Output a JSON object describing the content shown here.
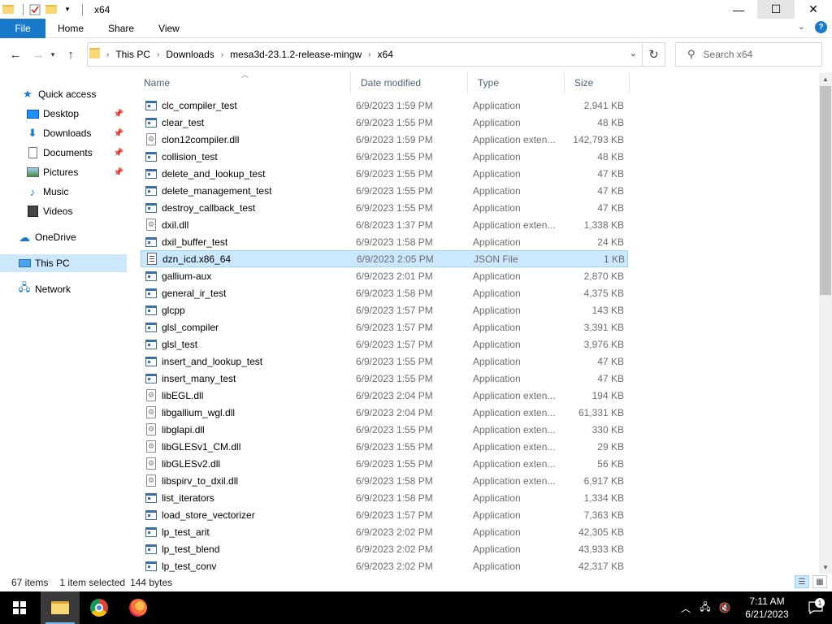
{
  "window": {
    "title": "x64",
    "minimize_glyph": "—",
    "maximize_glyph": "☐",
    "close_glyph": "✕"
  },
  "ribbon": {
    "tabs": [
      "File",
      "Home",
      "Share",
      "View"
    ]
  },
  "address": {
    "crumbs": [
      "This PC",
      "Downloads",
      "mesa3d-23.1.2-release-mingw",
      "x64"
    ],
    "search_placeholder": "Search x64"
  },
  "nav": {
    "quick_access": "Quick access",
    "items": [
      {
        "label": "Desktop",
        "icon": "desktop-icon",
        "pinned": true
      },
      {
        "label": "Downloads",
        "icon": "downloads-icon",
        "pinned": true
      },
      {
        "label": "Documents",
        "icon": "documents-icon",
        "pinned": true
      },
      {
        "label": "Pictures",
        "icon": "pictures-icon",
        "pinned": true
      },
      {
        "label": "Music",
        "icon": "music-icon",
        "pinned": false
      },
      {
        "label": "Videos",
        "icon": "videos-icon",
        "pinned": false
      }
    ],
    "onedrive": "OneDrive",
    "this_pc": "This PC",
    "network": "Network"
  },
  "columns": {
    "name": "Name",
    "date": "Date modified",
    "type": "Type",
    "size": "Size"
  },
  "files": [
    {
      "name": "clc_compiler_test",
      "date": "6/9/2023 1:59 PM",
      "type": "Application",
      "size": "2,941 KB",
      "kind": "app"
    },
    {
      "name": "clear_test",
      "date": "6/9/2023 1:55 PM",
      "type": "Application",
      "size": "48 KB",
      "kind": "app"
    },
    {
      "name": "clon12compiler.dll",
      "date": "6/9/2023 1:59 PM",
      "type": "Application exten...",
      "size": "142,793 KB",
      "kind": "dll"
    },
    {
      "name": "collision_test",
      "date": "6/9/2023 1:55 PM",
      "type": "Application",
      "size": "48 KB",
      "kind": "app"
    },
    {
      "name": "delete_and_lookup_test",
      "date": "6/9/2023 1:55 PM",
      "type": "Application",
      "size": "47 KB",
      "kind": "app"
    },
    {
      "name": "delete_management_test",
      "date": "6/9/2023 1:55 PM",
      "type": "Application",
      "size": "47 KB",
      "kind": "app"
    },
    {
      "name": "destroy_callback_test",
      "date": "6/9/2023 1:55 PM",
      "type": "Application",
      "size": "47 KB",
      "kind": "app"
    },
    {
      "name": "dxil.dll",
      "date": "6/8/2023 1:37 PM",
      "type": "Application exten...",
      "size": "1,338 KB",
      "kind": "dll"
    },
    {
      "name": "dxil_buffer_test",
      "date": "6/9/2023 1:58 PM",
      "type": "Application",
      "size": "24 KB",
      "kind": "app"
    },
    {
      "name": "dzn_icd.x86_64",
      "date": "6/9/2023 2:05 PM",
      "type": "JSON File",
      "size": "1 KB",
      "kind": "json",
      "selected": true
    },
    {
      "name": "gallium-aux",
      "date": "6/9/2023 2:01 PM",
      "type": "Application",
      "size": "2,870 KB",
      "kind": "app"
    },
    {
      "name": "general_ir_test",
      "date": "6/9/2023 1:58 PM",
      "type": "Application",
      "size": "4,375 KB",
      "kind": "app"
    },
    {
      "name": "glcpp",
      "date": "6/9/2023 1:57 PM",
      "type": "Application",
      "size": "143 KB",
      "kind": "app"
    },
    {
      "name": "glsl_compiler",
      "date": "6/9/2023 1:57 PM",
      "type": "Application",
      "size": "3,391 KB",
      "kind": "app"
    },
    {
      "name": "glsl_test",
      "date": "6/9/2023 1:57 PM",
      "type": "Application",
      "size": "3,976 KB",
      "kind": "app"
    },
    {
      "name": "insert_and_lookup_test",
      "date": "6/9/2023 1:55 PM",
      "type": "Application",
      "size": "47 KB",
      "kind": "app"
    },
    {
      "name": "insert_many_test",
      "date": "6/9/2023 1:55 PM",
      "type": "Application",
      "size": "47 KB",
      "kind": "app"
    },
    {
      "name": "libEGL.dll",
      "date": "6/9/2023 2:04 PM",
      "type": "Application exten...",
      "size": "194 KB",
      "kind": "dll"
    },
    {
      "name": "libgallium_wgl.dll",
      "date": "6/9/2023 2:04 PM",
      "type": "Application exten...",
      "size": "61,331 KB",
      "kind": "dll"
    },
    {
      "name": "libglapi.dll",
      "date": "6/9/2023 1:55 PM",
      "type": "Application exten...",
      "size": "330 KB",
      "kind": "dll"
    },
    {
      "name": "libGLESv1_CM.dll",
      "date": "6/9/2023 1:55 PM",
      "type": "Application exten...",
      "size": "29 KB",
      "kind": "dll"
    },
    {
      "name": "libGLESv2.dll",
      "date": "6/9/2023 1:55 PM",
      "type": "Application exten...",
      "size": "56 KB",
      "kind": "dll"
    },
    {
      "name": "libspirv_to_dxil.dll",
      "date": "6/9/2023 1:58 PM",
      "type": "Application exten...",
      "size": "6,917 KB",
      "kind": "dll"
    },
    {
      "name": "list_iterators",
      "date": "6/9/2023 1:58 PM",
      "type": "Application",
      "size": "1,334 KB",
      "kind": "app"
    },
    {
      "name": "load_store_vectorizer",
      "date": "6/9/2023 1:57 PM",
      "type": "Application",
      "size": "7,363 KB",
      "kind": "app"
    },
    {
      "name": "lp_test_arit",
      "date": "6/9/2023 2:02 PM",
      "type": "Application",
      "size": "42,305 KB",
      "kind": "app"
    },
    {
      "name": "lp_test_blend",
      "date": "6/9/2023 2:02 PM",
      "type": "Application",
      "size": "43,933 KB",
      "kind": "app"
    },
    {
      "name": "lp_test_conv",
      "date": "6/9/2023 2:02 PM",
      "type": "Application",
      "size": "42,317 KB",
      "kind": "app"
    }
  ],
  "status": {
    "items_count": "67 items",
    "selected": "1 item selected",
    "selected_size": "144 bytes"
  },
  "taskbar": {
    "time": "7:11 AM",
    "date": "6/21/2023",
    "notification_count": "1"
  }
}
